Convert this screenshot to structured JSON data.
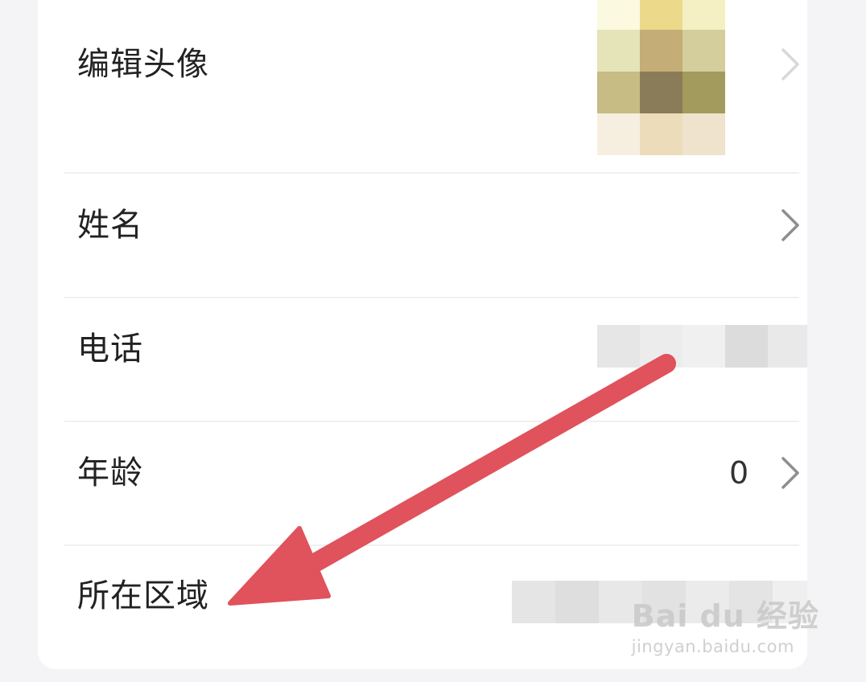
{
  "profile": {
    "rows": [
      {
        "label": "编辑头像"
      },
      {
        "label": "姓名"
      },
      {
        "label": "电话"
      },
      {
        "label": "年龄",
        "value": "0"
      },
      {
        "label": "所在区域"
      }
    ]
  },
  "colors": {
    "background": "#f4f4f6",
    "card": "#ffffff",
    "arrow": "#e0525c",
    "chevron": "#8e8e8e"
  },
  "watermark": {
    "main": "Bai du 经验",
    "sub": "jingyan.baidu.com"
  }
}
